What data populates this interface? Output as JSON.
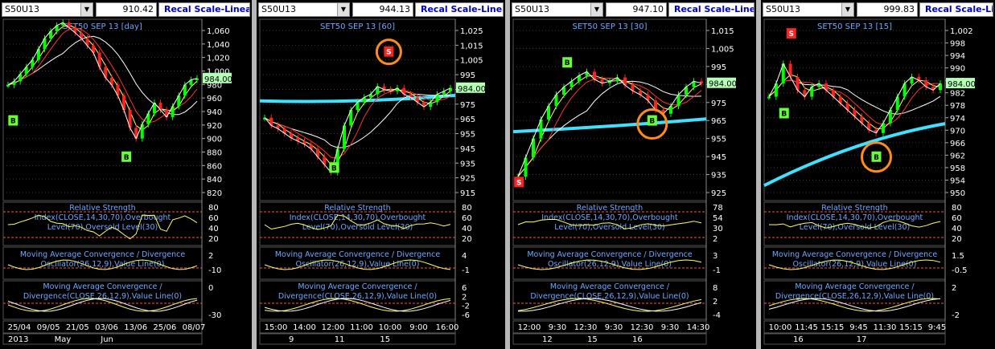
{
  "colors": {
    "price": "#ffffff",
    "ma1": "#ffff66",
    "ma2": "#ff3030",
    "ma3": "#ffffff",
    "ma_long": "#40e0ff",
    "bull": "#00ff00",
    "bear": "#ff2020",
    "grid": "#3a3a3a",
    "axis_text": "#ffffff",
    "title_text": "#6fa8ff",
    "marker_b": "#66ff33",
    "marker_s": "#ff2222",
    "circle": "#ff8c1a",
    "current": "#b6ffb6"
  },
  "panels": [
    {
      "symbol": "S50U13",
      "last_price": "910.42",
      "scale_label": "Recal Scale-Linear",
      "title": "SET50 SEP 13   [day]",
      "yticks": [
        "1,060",
        "1,040",
        "1,020",
        "1,000",
        "980",
        "960",
        "940",
        "920",
        "900",
        "880",
        "860",
        "840",
        "820"
      ],
      "current_label": "984.00",
      "rsi_title": [
        "Relative Strength",
        "Index(CLOSE,14,30,70),Overbought",
        "Level(70),Oversold Level(30)"
      ],
      "rsi_ticks": [
        "80",
        "60",
        "40",
        "20"
      ],
      "macd_osc_title": [
        "Moving Average Convergence / Divergence",
        "Oscillator(26,12,9),Value Line(0)"
      ],
      "macd_osc_ticks": [
        "2",
        "-10"
      ],
      "macd_title": [
        "Moving Average Convergence /",
        "Divergence(CLOSE,26,12,9),Value Line(0)"
      ],
      "macd_ticks": [
        "0",
        "-30"
      ],
      "xticks": [
        "25/04",
        "09/05",
        "21/05",
        "03/06",
        "13/06",
        "25/06",
        "08/07"
      ],
      "xtops": [
        "2013",
        "May",
        "Jun"
      ],
      "markers": [
        {
          "type": "B",
          "label": "B"
        },
        {
          "type": "B",
          "label": "B"
        }
      ]
    },
    {
      "symbol": "S50U13",
      "last_price": "944.13",
      "scale_label": "Recal Scale-Linear",
      "title": "SET50 SEP 13   [60]",
      "yticks": [
        "1,025",
        "1,015",
        "1,005",
        "995",
        "985",
        "975",
        "965",
        "955",
        "945",
        "935",
        "925",
        "915"
      ],
      "current_label": "984.00",
      "rsi_title": [
        "Relative Strength",
        "Index(CLOSE,14,30,70),Overbought",
        "Level(70),Oversold Level(30)"
      ],
      "rsi_ticks": [
        "80",
        "60",
        "40",
        "20"
      ],
      "macd_osc_title": [
        "Moving Average Convergence / Divergence",
        "Oscillator(26,12,9),Value Line(0)"
      ],
      "macd_osc_ticks": [
        "4",
        "-1"
      ],
      "macd_title": [
        "Moving Average Convergence /",
        "Divergence(CLOSE,26,12,9),Value Line(0)"
      ],
      "macd_ticks": [
        "6",
        "2",
        "-2",
        "-6"
      ],
      "xticks": [
        "15:00",
        "14:00",
        "12:00",
        "11:00",
        "10:00",
        "9:00",
        "16:00"
      ],
      "xtops": [
        "9",
        "11",
        "15"
      ],
      "markers": [
        {
          "type": "B",
          "label": "B"
        },
        {
          "type": "S",
          "label": "S"
        }
      ]
    },
    {
      "symbol": "S50U13",
      "last_price": "947.10",
      "scale_label": "Recal Scale-Linear",
      "title": "SET50 SEP 13   [30]",
      "yticks": [
        "1,015",
        "1,005",
        "995",
        "985",
        "975",
        "965",
        "955",
        "945",
        "935",
        "925"
      ],
      "current_label": "984.00",
      "rsi_title": [
        "Relative Strength",
        "Index(CLOSE,14,30,70),Overbought",
        "Level(70),Oversold Level(30)"
      ],
      "rsi_ticks": [
        "78",
        "54",
        "30",
        "2"
      ],
      "macd_osc_title": [
        "Moving Average Convergence / Divergence",
        "Oscillator(26,12,9),Value Line(0)"
      ],
      "macd_osc_ticks": [
        "3",
        "-1"
      ],
      "macd_title": [
        "Moving Average Convergence /",
        "Divergence(CLOSE,26,12,9),Value Line(0)"
      ],
      "macd_ticks": [
        "8",
        "2",
        "-4"
      ],
      "xticks": [
        "12:00",
        "9:30",
        "12:30",
        "9:30",
        "12:30",
        "9:30",
        "14:30"
      ],
      "xtops": [
        "12",
        "15",
        "16"
      ],
      "markers": [
        {
          "type": "S",
          "label": "S"
        },
        {
          "type": "B",
          "label": "B"
        },
        {
          "type": "B",
          "label": "B"
        }
      ]
    },
    {
      "symbol": "S50U13",
      "last_price": "999.83",
      "scale_label": "Recal Scale-Linear",
      "title": "SET50 SEP 13   [15]",
      "yticks": [
        "1,002",
        "998",
        "994",
        "990",
        "986",
        "982",
        "978",
        "974",
        "970",
        "966",
        "962",
        "958",
        "954",
        "950"
      ],
      "current_label": "984.00",
      "rsi_title": [
        "Relative Strength",
        "Index(CLOSE,14,30,70),Overbought",
        "Level(70),Oversold Level(30)"
      ],
      "rsi_ticks": [
        "80",
        "60",
        "40",
        "20"
      ],
      "macd_osc_title": [
        "Moving Average Convergence / Divergence",
        "Oscillator(26,12,9),Value Line(0)"
      ],
      "macd_osc_ticks": [
        "1.5",
        "-0.5"
      ],
      "macd_title": [
        "Moving Average Convergence /",
        "Divergence(CLOSE,26,12,9),Value Line(0)"
      ],
      "macd_ticks": [
        "2",
        "-2"
      ],
      "xticks": [
        "10:00",
        "11:45",
        "15:15",
        "9:45",
        "11:30",
        "15:15",
        "9:45"
      ],
      "xtops": [
        "16",
        "17"
      ],
      "markers": [
        {
          "type": "S",
          "label": "S"
        },
        {
          "type": "B",
          "label": "B"
        },
        {
          "type": "B",
          "label": "B"
        }
      ]
    }
  ],
  "chart_data": [
    {
      "type": "line",
      "title": "SET50 SEP 13   [day]",
      "ylim": [
        820,
        1060
      ],
      "series": [
        {
          "values": [
            975,
            980,
            990,
            1000,
            1010,
            1025,
            1040,
            1050,
            1058,
            1062,
            1055,
            1048,
            1040,
            1030,
            1020,
            1000,
            985,
            975,
            960,
            940,
            915,
            900,
            920,
            935,
            950,
            940,
            930,
            945,
            960,
            975,
            982,
            984
          ]
        }
      ]
    },
    {
      "type": "line",
      "title": "SET50 SEP 13   [60]",
      "ylim": [
        915,
        1025
      ],
      "series": [
        {
          "values": [
            965,
            960,
            958,
            955,
            952,
            950,
            948,
            945,
            940,
            935,
            930,
            945,
            960,
            970,
            975,
            978,
            980,
            985,
            983,
            982,
            984,
            980,
            978,
            975,
            972,
            975,
            980,
            982,
            984
          ]
        }
      ]
    },
    {
      "type": "line",
      "title": "SET50 SEP 13   [30]",
      "ylim": [
        925,
        1015
      ],
      "series": [
        {
          "values": [
            935,
            945,
            955,
            965,
            972,
            978,
            982,
            985,
            988,
            990,
            986,
            984,
            985,
            987,
            983,
            980,
            978,
            975,
            970,
            968,
            972,
            978,
            982,
            985,
            984
          ]
        }
      ]
    },
    {
      "type": "line",
      "title": "SET50 SEP 13   [15]",
      "ylim": [
        950,
        1002
      ],
      "series": [
        {
          "values": [
            980,
            984,
            990,
            986,
            982,
            980,
            983,
            984,
            982,
            980,
            978,
            976,
            974,
            972,
            970,
            969,
            972,
            976,
            980,
            984,
            986,
            985,
            983,
            982,
            984
          ]
        }
      ]
    }
  ]
}
